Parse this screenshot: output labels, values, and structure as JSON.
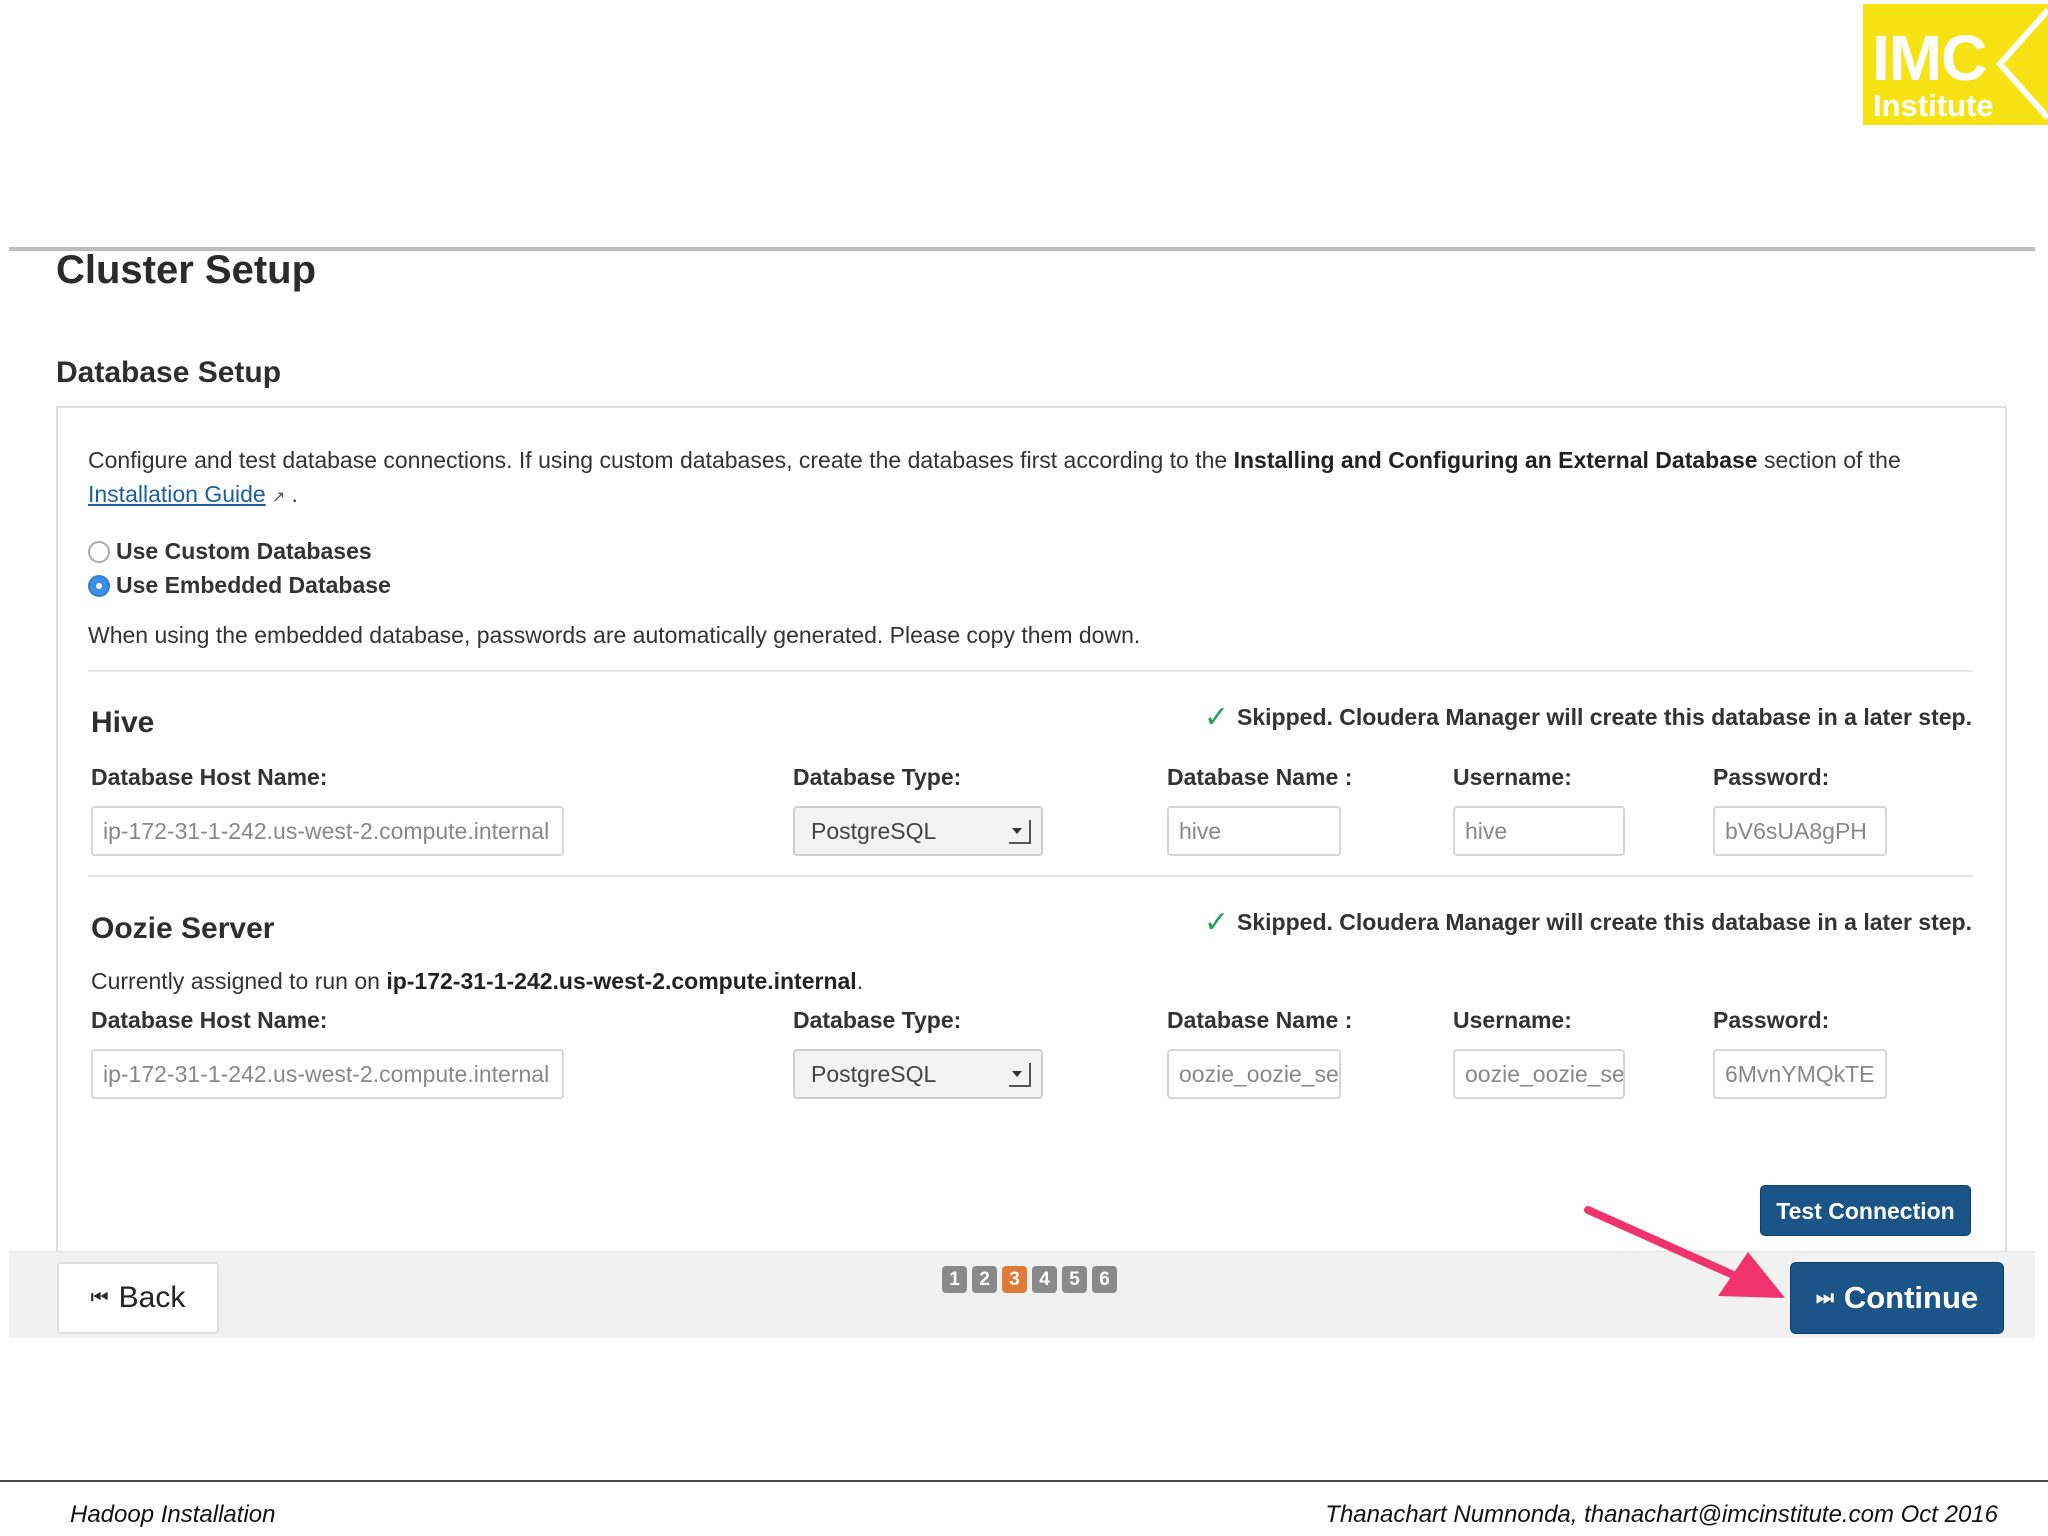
{
  "logo": {
    "line1": "IMC",
    "line2": "Institute",
    "color": "#f7e314"
  },
  "page_title": "Cluster Setup",
  "section_title": "Database Setup",
  "intro": {
    "text1": "Configure and test database connections. If using custom databases, create the databases first according to the ",
    "bold": "Installing and Configuring an External Database",
    "text2": " section of the",
    "link": "Installation Guide",
    "period": "."
  },
  "radio_options": [
    {
      "label": "Use Custom Databases",
      "selected": false
    },
    {
      "label": "Use Embedded Database",
      "selected": true
    }
  ],
  "embedded_note": "When using the embedded database, passwords are automatically generated. Please copy them down.",
  "labels": {
    "host": "Database Host Name:",
    "type": "Database Type:",
    "dbname": "Database Name :",
    "username": "Username:",
    "password": "Password:"
  },
  "services": [
    {
      "title": "Hive",
      "skipped": "Skipped. Cloudera Manager will create this database in a later step.",
      "host": "ip-172-31-1-242.us-west-2.compute.internal",
      "type": "PostgreSQL",
      "dbname": "hive",
      "username": "hive",
      "password": "bV6sUA8gPH"
    },
    {
      "title": "Oozie Server",
      "skipped": "Skipped. Cloudera Manager will create this database in a later step.",
      "assigned_prefix": "Currently assigned to run on ",
      "assigned_host": "ip-172-31-1-242.us-west-2.compute.internal",
      "assigned_suffix": ".",
      "host": "ip-172-31-1-242.us-west-2.compute.internal",
      "type": "PostgreSQL",
      "dbname": "oozie_oozie_server",
      "username": "oozie_oozie_server",
      "password": "6MvnYMQkTE"
    }
  ],
  "buttons": {
    "test_connection": "Test Connection",
    "back": "Back",
    "continue": "Continue"
  },
  "steps": {
    "items": [
      "1",
      "2",
      "3",
      "4",
      "5",
      "6"
    ],
    "active": "3"
  },
  "footer": {
    "left": "Hadoop Installation",
    "right": "Thanachart Numnonda,  thanachart@imcinstitute.com  Oct 2016"
  },
  "colors": {
    "primary_button": "#1b5587",
    "active_step": "#e07b35",
    "annotation_arrow": "#f0336f",
    "check": "#2aa05b"
  }
}
